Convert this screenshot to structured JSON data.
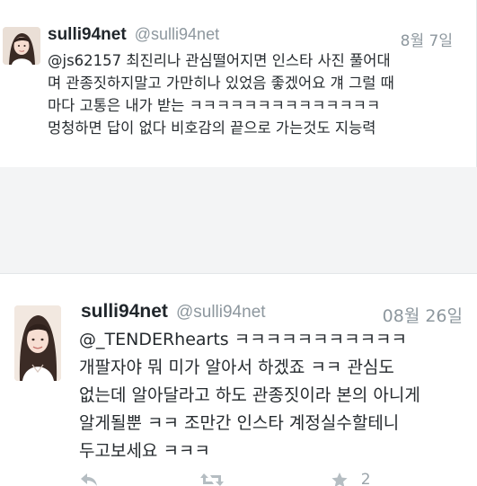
{
  "tweets": [
    {
      "display_name": "sulli94net",
      "handle": "@sulli94net",
      "date": "8월 7일",
      "lines": [
        "@js62157 최진리나 관심떨어지면 인스타 사진 풀어대",
        "며 관종짓하지말고 가만히나 있었음 좋겠어요 걔 그럴 때",
        "마다 고통은 내가 받는 ㅋㅋㅋㅋㅋㅋㅋㅋㅋㅋㅋㅋㅋㅋ",
        "멍청하면 답이 없다 비호감의 끝으로 가는것도 지능력"
      ]
    },
    {
      "display_name": "sulli94net",
      "handle": "@sulli94net",
      "date": "08월 26일",
      "lines": [
        "@_TENDERhearts ㅋㅋㅋㅋㅋㅋㅋㅋㅋㅋㅋ",
        "개팔자야 뭐 미가 알아서 하겠죠 ㅋㅋ 관심도",
        "없는데 알아달라고 하도 관종짓이라 본의 아니게",
        "알게될뿐 ㅋㅋ 조만간 인스타 계정실수할테니",
        "두고보세요 ㅋㅋㅋ"
      ],
      "actions": {
        "reply_icon": "reply-icon",
        "retweet_icon": "retweet-icon",
        "favorite_icon": "star-icon",
        "favorite_count": "2"
      }
    }
  ],
  "colors": {
    "name": "#20262b",
    "meta": "#8d979e",
    "action": "#b5bdc2",
    "background": "#f3f4f5"
  }
}
